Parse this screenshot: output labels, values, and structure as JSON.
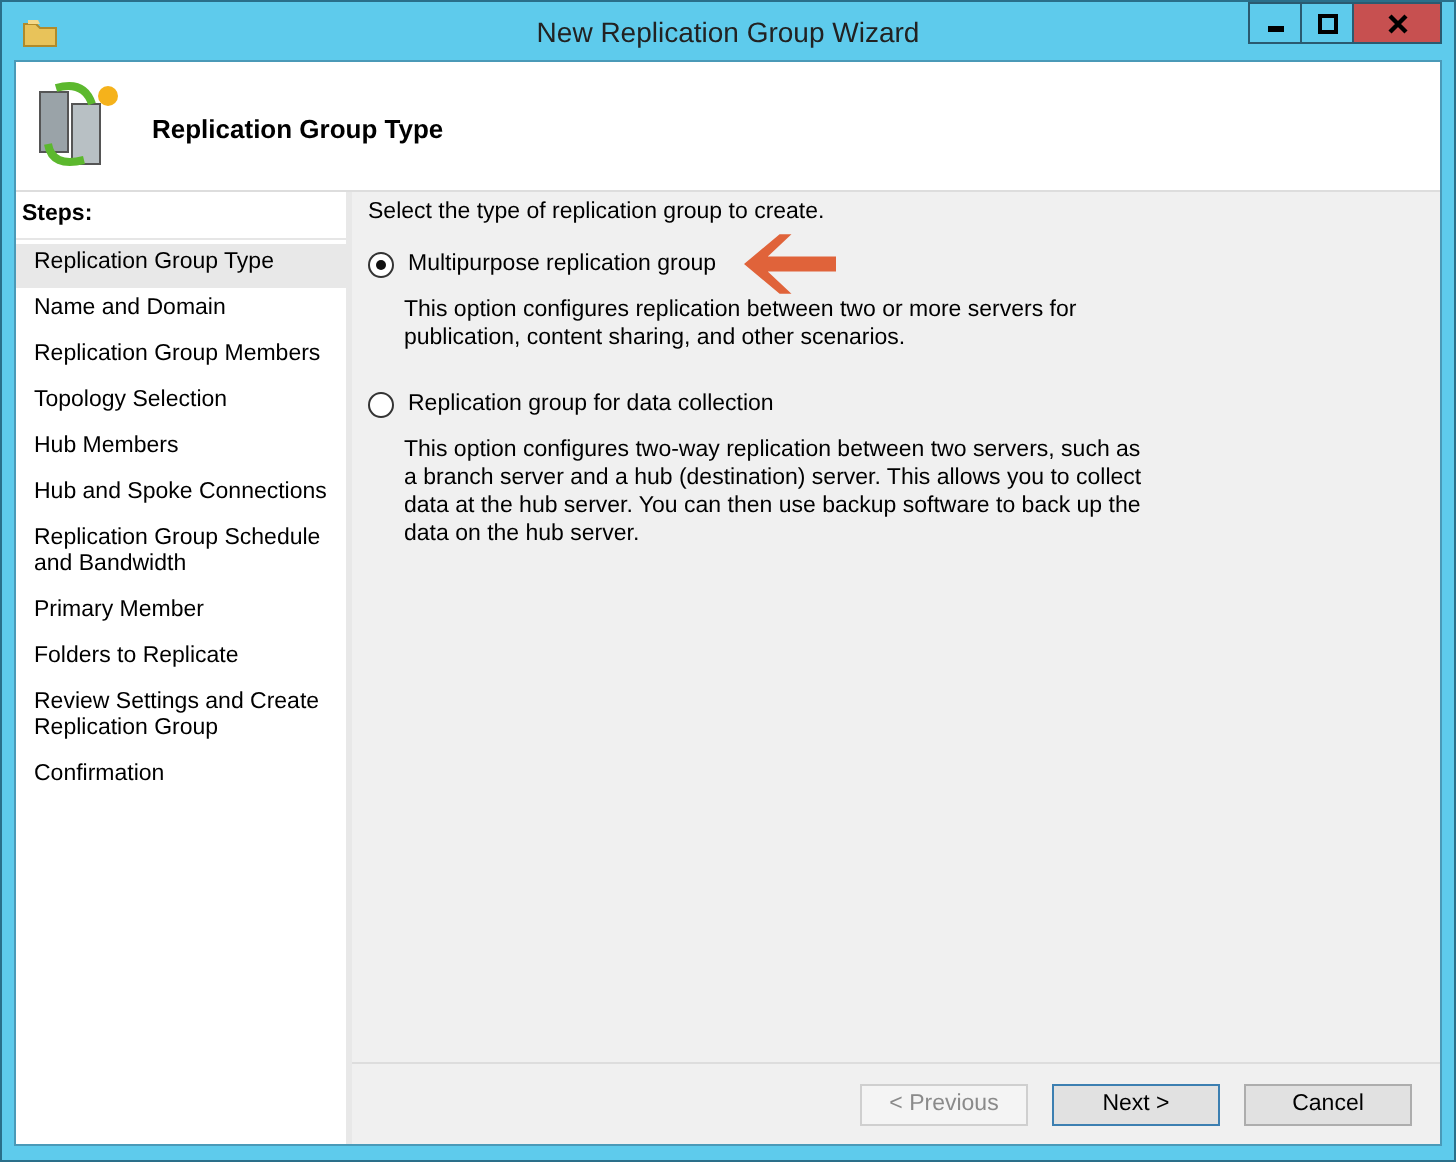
{
  "window": {
    "title": "New Replication Group Wizard"
  },
  "header": {
    "title": "Replication Group Type"
  },
  "steps": {
    "heading": "Steps:",
    "items": [
      {
        "label": "Replication Group Type",
        "selected": true
      },
      {
        "label": "Name and Domain",
        "selected": false
      },
      {
        "label": "Replication Group Members",
        "selected": false
      },
      {
        "label": "Topology Selection",
        "selected": false
      },
      {
        "label": "Hub Members",
        "selected": false
      },
      {
        "label": "Hub and Spoke Connections",
        "selected": false
      },
      {
        "label": "Replication Group Schedule and Bandwidth",
        "selected": false
      },
      {
        "label": "Primary Member",
        "selected": false
      },
      {
        "label": "Folders to Replicate",
        "selected": false
      },
      {
        "label": "Review Settings and Create Replication Group",
        "selected": false
      },
      {
        "label": "Confirmation",
        "selected": false
      }
    ]
  },
  "content": {
    "instruction": "Select the type of replication group to create.",
    "options": [
      {
        "label": "Multipurpose replication group",
        "selected": true,
        "annotated": true,
        "description": "This option configures replication between two or more servers for publication, content sharing, and other scenarios."
      },
      {
        "label": "Replication group for data collection",
        "selected": false,
        "annotated": false,
        "description": "This option configures two-way replication between two servers, such as a branch server and a hub (destination) server. This allows you to collect data at the hub server. You can then use backup software to back up the data on the hub server."
      }
    ]
  },
  "buttons": [
    {
      "label": "< Previous",
      "disabled": true,
      "default": false
    },
    {
      "label": "Next >",
      "disabled": false,
      "default": true
    },
    {
      "label": "Cancel",
      "disabled": false,
      "default": false
    }
  ]
}
